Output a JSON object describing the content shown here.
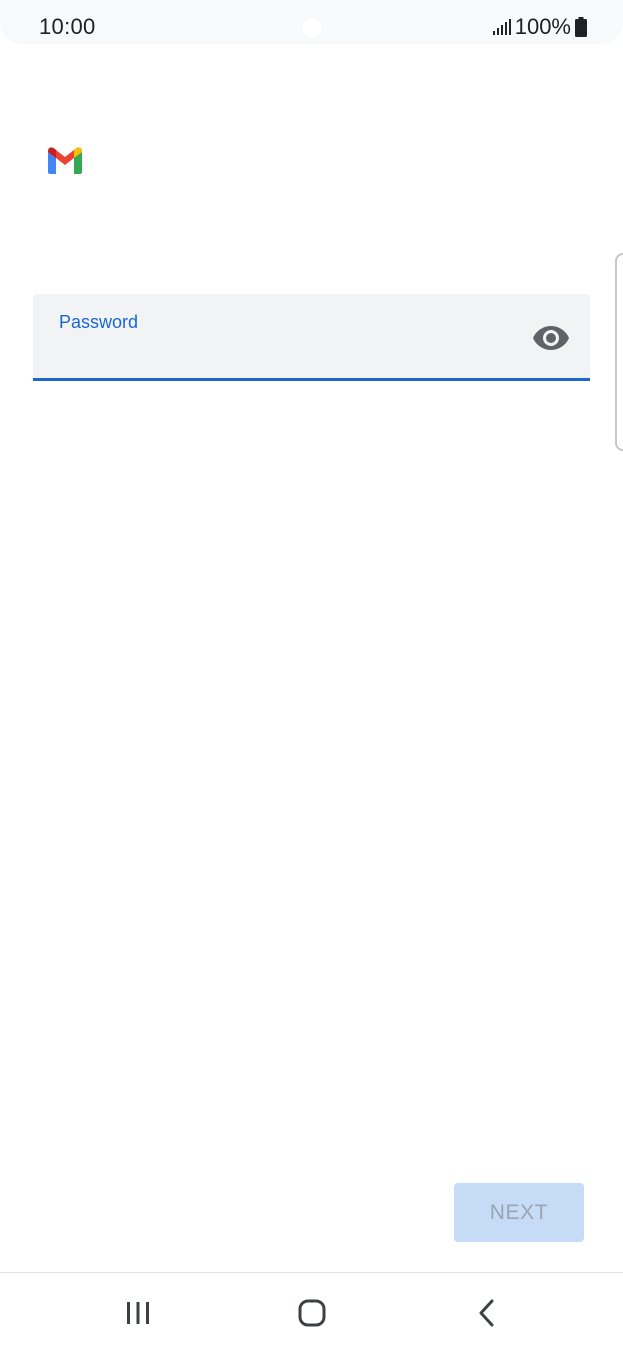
{
  "status_bar": {
    "time": "10:00",
    "battery_percent": "100%",
    "signal_icon": "signal-bars-icon",
    "battery_icon": "battery-icon"
  },
  "app": {
    "logo_icon": "gmail-logo-icon",
    "logo_colors": [
      "#ea4335",
      "#4285f4",
      "#34a853",
      "#fbbc04",
      "#c5221f"
    ]
  },
  "form": {
    "password_label": "Password",
    "password_value": "",
    "visibility_toggle_icon": "eye-icon",
    "accent_color": "#1a67d2"
  },
  "actions": {
    "next_label": "NEXT",
    "next_enabled": false
  },
  "nav_bar": {
    "recents_icon": "recents-icon",
    "home_icon": "home-icon",
    "back_icon": "back-icon"
  }
}
